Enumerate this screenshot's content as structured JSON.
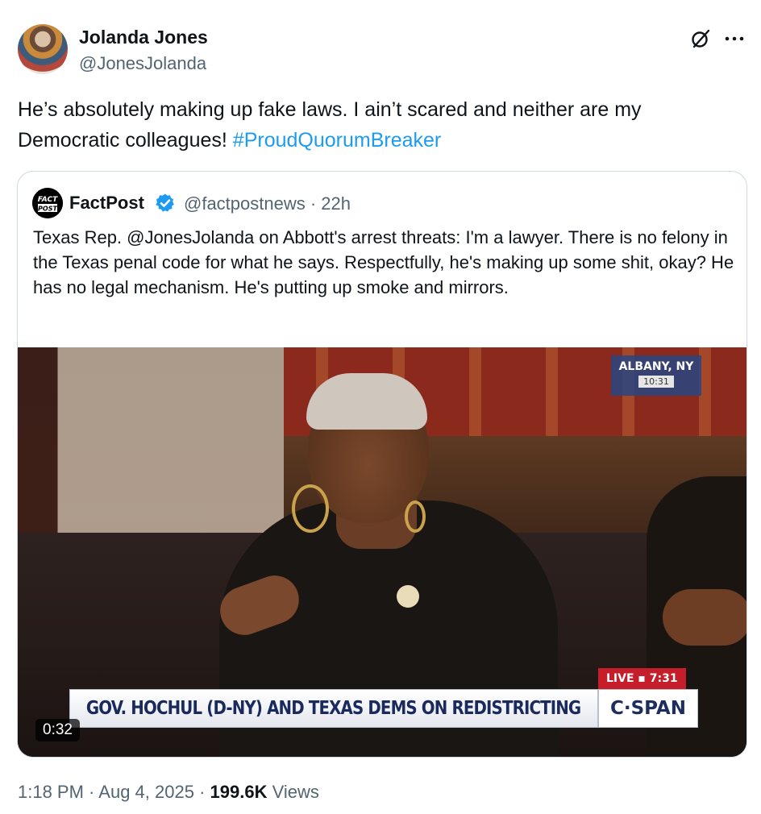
{
  "tweet": {
    "author": {
      "name": "Jolanda Jones",
      "handle": "@JonesJolanda"
    },
    "text_main": "He’s absolutely making up fake laws. I ain’t scared and neither are my Democratic colleagues! ",
    "hashtag": "#ProudQuorumBreaker",
    "icons": {
      "grok": "grok-icon",
      "more": "more-icon"
    }
  },
  "quote": {
    "logo_text_top": "FACT",
    "logo_text_bottom": "POST",
    "name": "FactPost",
    "verified_icon": "verified-icon",
    "handle_time": "@factpostnews · 22h",
    "text": "Texas Rep. @JonesJolanda on Abbott's arrest threats: I'm a lawyer. There is no felony in the Texas penal code for what he says. Respectfully, he's making up some shit, okay? He has no legal mechanism. He's putting up smoke and mirrors."
  },
  "video": {
    "location": "ALBANY, NY",
    "location_time": "10:31",
    "live_label": "LIVE ▪ 7:31",
    "chyron": "GOV. HOCHUL (D-NY) AND TEXAS DEMS ON REDISTRICTING",
    "network": "C·SPAN",
    "duration": "0:32"
  },
  "meta": {
    "time": "1:18 PM",
    "date": "Aug 4, 2025",
    "views_count": "199.6K",
    "views_label": "Views",
    "separator": " · "
  }
}
